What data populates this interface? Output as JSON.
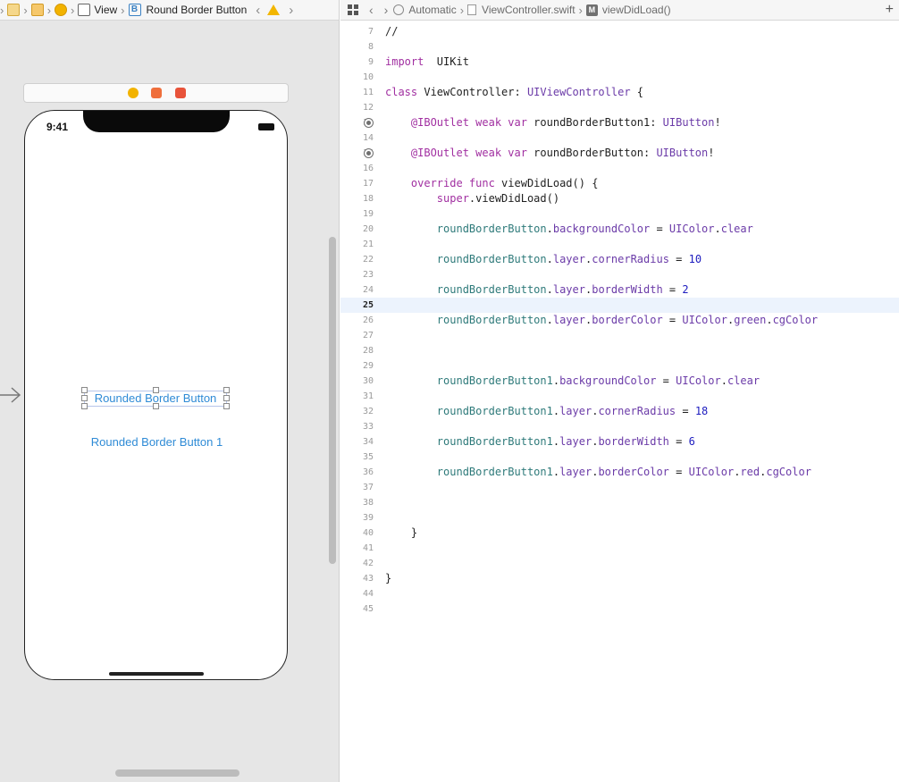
{
  "ib_bar": {
    "crumbs": [
      "View",
      "Round Border Button"
    ],
    "badge": "B"
  },
  "editor_bar": {
    "mode": "Automatic",
    "file": "ViewController.swift",
    "symbol_badge": "M",
    "symbol": "viewDidLoad()",
    "add_label": "+"
  },
  "phone": {
    "time": "9:41",
    "button_1_label": "Rounded Border Button",
    "button_2_label": "Rounded Border Button 1"
  },
  "code": {
    "current_line": 25,
    "lines": [
      {
        "n": 7,
        "tokens": [
          [
            "cm",
            "//"
          ]
        ]
      },
      {
        "n": 8,
        "tokens": []
      },
      {
        "n": 9,
        "tokens": [
          [
            "kw",
            "import"
          ],
          [
            "",
            "  UIKit"
          ]
        ]
      },
      {
        "n": 10,
        "tokens": []
      },
      {
        "n": 11,
        "tokens": [
          [
            "kw",
            "class"
          ],
          [
            "",
            " ViewController: "
          ],
          [
            "ty",
            "UIViewController"
          ],
          [
            "",
            " {"
          ]
        ]
      },
      {
        "n": 12,
        "tokens": []
      },
      {
        "n": 13,
        "outlet": true,
        "tokens": [
          [
            "",
            "    "
          ],
          [
            "kw",
            "@IBOutlet weak var"
          ],
          [
            "",
            " roundBorderButton1: "
          ],
          [
            "ty",
            "UIButton"
          ],
          [
            "",
            "!"
          ]
        ]
      },
      {
        "n": 14,
        "tokens": []
      },
      {
        "n": 15,
        "outlet": true,
        "tokens": [
          [
            "",
            "    "
          ],
          [
            "kw",
            "@IBOutlet weak var"
          ],
          [
            "",
            " roundBorderButton: "
          ],
          [
            "ty",
            "UIButton"
          ],
          [
            "",
            "!"
          ]
        ]
      },
      {
        "n": 16,
        "tokens": []
      },
      {
        "n": 17,
        "tokens": [
          [
            "",
            "    "
          ],
          [
            "kw",
            "override func"
          ],
          [
            "",
            " viewDidLoad() {"
          ]
        ]
      },
      {
        "n": 18,
        "tokens": [
          [
            "",
            "        "
          ],
          [
            "kw",
            "super"
          ],
          [
            ".viewDidLoad()",
            ""
          ]
        ]
      },
      {
        "n": 19,
        "tokens": []
      },
      {
        "n": 20,
        "tokens": [
          [
            "",
            "        "
          ],
          [
            "pr",
            "roundBorderButton"
          ],
          [
            "",
            "."
          ],
          [
            "ap",
            "backgroundColor"
          ],
          [
            "",
            " = "
          ],
          [
            "ty",
            "UIColor"
          ],
          [
            "",
            "."
          ],
          [
            "ap",
            "clear"
          ]
        ]
      },
      {
        "n": 21,
        "tokens": []
      },
      {
        "n": 22,
        "tokens": [
          [
            "",
            "        "
          ],
          [
            "pr",
            "roundBorderButton"
          ],
          [
            "",
            "."
          ],
          [
            "ap",
            "layer"
          ],
          [
            "",
            "."
          ],
          [
            "ap",
            "cornerRadius"
          ],
          [
            "",
            " = "
          ],
          [
            "nm",
            "10"
          ]
        ]
      },
      {
        "n": 23,
        "tokens": []
      },
      {
        "n": 24,
        "tokens": [
          [
            "",
            "        "
          ],
          [
            "pr",
            "roundBorderButton"
          ],
          [
            "",
            "."
          ],
          [
            "ap",
            "layer"
          ],
          [
            "",
            "."
          ],
          [
            "ap",
            "borderWidth"
          ],
          [
            "",
            " = "
          ],
          [
            "nm",
            "2"
          ]
        ]
      },
      {
        "n": 25,
        "tokens": []
      },
      {
        "n": 26,
        "tokens": [
          [
            "",
            "        "
          ],
          [
            "pr",
            "roundBorderButton"
          ],
          [
            "",
            "."
          ],
          [
            "ap",
            "layer"
          ],
          [
            "",
            "."
          ],
          [
            "ap",
            "borderColor"
          ],
          [
            "",
            " = "
          ],
          [
            "ty",
            "UIColor"
          ],
          [
            "",
            "."
          ],
          [
            "ap",
            "green"
          ],
          [
            "",
            "."
          ],
          [
            "ap",
            "cgColor"
          ]
        ]
      },
      {
        "n": 27,
        "tokens": []
      },
      {
        "n": 28,
        "tokens": []
      },
      {
        "n": 29,
        "tokens": []
      },
      {
        "n": 30,
        "tokens": [
          [
            "",
            "        "
          ],
          [
            "pr",
            "roundBorderButton1"
          ],
          [
            "",
            "."
          ],
          [
            "ap",
            "backgroundColor"
          ],
          [
            "",
            " = "
          ],
          [
            "ty",
            "UIColor"
          ],
          [
            "",
            "."
          ],
          [
            "ap",
            "clear"
          ]
        ]
      },
      {
        "n": 31,
        "tokens": []
      },
      {
        "n": 32,
        "tokens": [
          [
            "",
            "        "
          ],
          [
            "pr",
            "roundBorderButton1"
          ],
          [
            "",
            "."
          ],
          [
            "ap",
            "layer"
          ],
          [
            "",
            "."
          ],
          [
            "ap",
            "cornerRadius"
          ],
          [
            "",
            " = "
          ],
          [
            "nm",
            "18"
          ]
        ]
      },
      {
        "n": 33,
        "tokens": []
      },
      {
        "n": 34,
        "tokens": [
          [
            "",
            "        "
          ],
          [
            "pr",
            "roundBorderButton1"
          ],
          [
            "",
            "."
          ],
          [
            "ap",
            "layer"
          ],
          [
            "",
            "."
          ],
          [
            "ap",
            "borderWidth"
          ],
          [
            "",
            " = "
          ],
          [
            "nm",
            "6"
          ]
        ]
      },
      {
        "n": 35,
        "tokens": []
      },
      {
        "n": 36,
        "tokens": [
          [
            "",
            "        "
          ],
          [
            "pr",
            "roundBorderButton1"
          ],
          [
            "",
            "."
          ],
          [
            "ap",
            "layer"
          ],
          [
            "",
            "."
          ],
          [
            "ap",
            "borderColor"
          ],
          [
            "",
            " = "
          ],
          [
            "ty",
            "UIColor"
          ],
          [
            "",
            "."
          ],
          [
            "ap",
            "red"
          ],
          [
            "",
            "."
          ],
          [
            "ap",
            "cgColor"
          ]
        ]
      },
      {
        "n": 37,
        "tokens": []
      },
      {
        "n": 38,
        "tokens": []
      },
      {
        "n": 39,
        "tokens": []
      },
      {
        "n": 40,
        "tokens": [
          [
            "",
            "    }"
          ]
        ]
      },
      {
        "n": 41,
        "tokens": []
      },
      {
        "n": 42,
        "tokens": []
      },
      {
        "n": 43,
        "tokens": [
          [
            "",
            "}"
          ]
        ]
      },
      {
        "n": 44,
        "tokens": []
      },
      {
        "n": 45,
        "tokens": []
      }
    ]
  }
}
